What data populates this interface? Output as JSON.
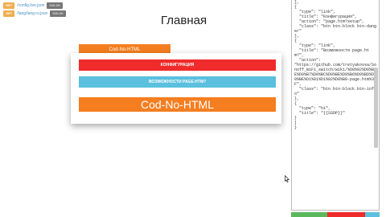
{
  "network_log": [
    {
      "method": "GET",
      "url": "/config.live.json",
      "status": "200 OK"
    },
    {
      "method": "GET",
      "url": "/lang/lang.ru.json",
      "status": "200 OK"
    }
  ],
  "page": {
    "title": "Главная"
  },
  "tab": {
    "label": "Cod-No-HTML"
  },
  "panel": {
    "config_button": "КОНФИГУРАЦИЯ",
    "features_button": "ВОЗМОЖНОСТИ PAGE.HTM?",
    "heading": "Cod-No-HTML"
  },
  "editor": {
    "code": "},\n{\n  \"type\": \"link\",\n  \"title\": \"Конфигурация\",\n  \"action\": \"page.htm?setup\",\n  \"class\": \"btn btn-block btn-danger\"\n},\n{\n  \"type\": \"link\",\n  \"title\": \"Возможности page.htm?\",\n  \"action\":\n\"https://github.com/tretyakovsa/Sonoff_WiFi_switch/wiki/%D0%92%D0%BE%D0%B7%D0%BC%D0%BE%D0%B6%D0%BD%D0%BE%D1%81%D1%82%D0%B8-page.htm%3F\",\n  \"class\": \"btn btn-block btn-info\"\n},\n{\n  \"type\": \"h1\",\n  \"title\": \"{{SSDP}}\"\n}\n]\n}"
  },
  "colors": {
    "orange": "#f47e20",
    "danger": "#ef2b2b",
    "info": "#5bc0de",
    "get_badge": "#f0ad4e",
    "status_badge": "#777777",
    "footer_green": "#5cb85c",
    "footer_red": "#ef2b2b",
    "footer_blue": "#5bc0de"
  }
}
